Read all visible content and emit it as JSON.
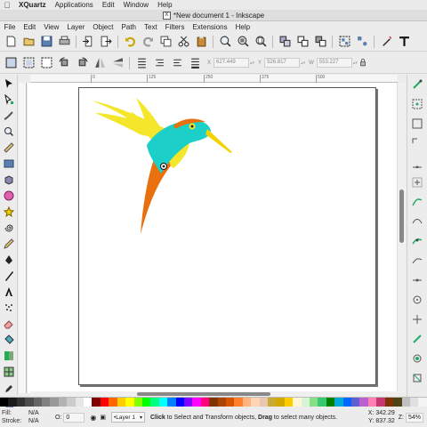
{
  "mac_menubar": {
    "app": "XQuartz",
    "items": [
      "Applications",
      "Edit",
      "Window",
      "Help"
    ]
  },
  "window": {
    "title": "*New document 1 - Inkscape"
  },
  "menubar": {
    "items": [
      "File",
      "Edit",
      "View",
      "Layer",
      "Object",
      "Path",
      "Text",
      "Filters",
      "Extensions",
      "Help"
    ]
  },
  "toolbar2": {
    "x_label": "X",
    "x_value": "627.449",
    "y_label": "Y",
    "y_value": "526.817",
    "w_label": "W",
    "w_value": "553.227"
  },
  "ruler": {
    "ticks": [
      "0",
      "125",
      "250",
      "375",
      "500"
    ]
  },
  "status": {
    "fill_label": "Fill:",
    "fill_value": "N/A",
    "stroke_label": "Stroke:",
    "stroke_value": "N/A",
    "opacity_label": "O:",
    "opacity_value": "0",
    "layer": "•Layer 1",
    "message_bold1": "Click",
    "message_part1": " to Select and Transform objects, ",
    "message_bold2": "Drag",
    "message_part2": " to select many objects.",
    "x_label": "X:",
    "x_value": "342.29",
    "y_label": "Y:",
    "y_value": "837.32",
    "zoom_label": "Z:",
    "zoom_value": "54%"
  },
  "colors": {
    "bird_teal": "#1ccfc9",
    "bird_yellow": "#f4e62a",
    "bird_orange": "#e8700e",
    "bird_beak": "#f2d400"
  },
  "palette": [
    "#000000",
    "#1a1a1a",
    "#333333",
    "#4d4d4d",
    "#666666",
    "#808080",
    "#999999",
    "#b3b3b3",
    "#cccccc",
    "#e6e6e6",
    "#ffffff",
    "#800000",
    "#ff0000",
    "#ff6600",
    "#ffcc00",
    "#ffff00",
    "#80ff00",
    "#00ff00",
    "#00ff80",
    "#00ffff",
    "#0080ff",
    "#0000ff",
    "#8000ff",
    "#ff00ff",
    "#ff0080",
    "#803300",
    "#aa4400",
    "#d45500",
    "#ff7f2a",
    "#ffb380",
    "#ffd5b3",
    "#e9c6af",
    "#c8ab37",
    "#d4aa00",
    "#ffcc00",
    "#fff6d5",
    "#d7f4d7",
    "#87de87",
    "#37c871",
    "#008000",
    "#00aad4",
    "#0066ff",
    "#5f5fd3",
    "#bc5fd3",
    "#ff80b2",
    "#c83771",
    "#803300",
    "#504416",
    "#c0c0c0",
    "#e0e0e0",
    "#f4f4f4"
  ]
}
